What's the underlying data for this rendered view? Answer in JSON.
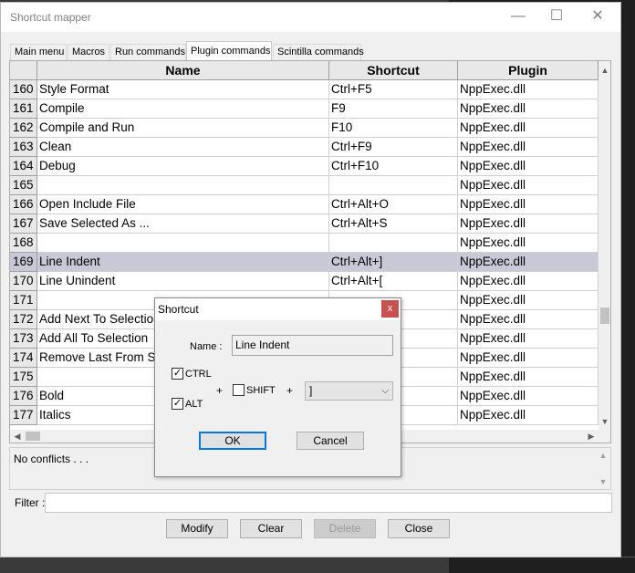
{
  "window": {
    "title": "Shortcut mapper",
    "minimize": "—",
    "maximize": "☐",
    "close": "✕"
  },
  "tabs": [
    "Main menu",
    "Macros",
    "Run commands",
    "Plugin commands",
    "Scintilla commands"
  ],
  "active_tab": "Plugin commands",
  "table": {
    "columns": [
      "Name",
      "Shortcut",
      "Plugin"
    ],
    "rows": [
      {
        "num": "160",
        "name": "Style Format",
        "shortcut": "Ctrl+F5",
        "plugin": "NppExec.dll"
      },
      {
        "num": "161",
        "name": "Compile",
        "shortcut": "F9",
        "plugin": "NppExec.dll"
      },
      {
        "num": "162",
        "name": "Compile and Run",
        "shortcut": "F10",
        "plugin": "NppExec.dll"
      },
      {
        "num": "163",
        "name": "Clean",
        "shortcut": "Ctrl+F9",
        "plugin": "NppExec.dll"
      },
      {
        "num": "164",
        "name": "Debug",
        "shortcut": "Ctrl+F10",
        "plugin": "NppExec.dll"
      },
      {
        "num": "165",
        "name": "",
        "shortcut": "",
        "plugin": "NppExec.dll"
      },
      {
        "num": "166",
        "name": "Open Include File",
        "shortcut": "Ctrl+Alt+O",
        "plugin": "NppExec.dll"
      },
      {
        "num": "167",
        "name": "Save Selected As ...",
        "shortcut": "Ctrl+Alt+S",
        "plugin": "NppExec.dll"
      },
      {
        "num": "168",
        "name": "",
        "shortcut": "",
        "plugin": "NppExec.dll"
      },
      {
        "num": "169",
        "name": "Line Indent",
        "shortcut": "Ctrl+Alt+]",
        "plugin": "NppExec.dll"
      },
      {
        "num": "170",
        "name": "Line Unindent",
        "shortcut": "Ctrl+Alt+[",
        "plugin": "NppExec.dll"
      },
      {
        "num": "171",
        "name": "",
        "shortcut": "",
        "plugin": "NppExec.dll"
      },
      {
        "num": "172",
        "name": "Add Next To Selection",
        "shortcut": "",
        "plugin": "NppExec.dll"
      },
      {
        "num": "173",
        "name": "Add All To Selection",
        "shortcut": "",
        "plugin": "NppExec.dll"
      },
      {
        "num": "174",
        "name": "Remove Last From Selection",
        "shortcut": "",
        "plugin": "NppExec.dll"
      },
      {
        "num": "175",
        "name": "",
        "shortcut": "",
        "plugin": "NppExec.dll"
      },
      {
        "num": "176",
        "name": "Bold",
        "shortcut": "",
        "plugin": "NppExec.dll"
      },
      {
        "num": "177",
        "name": "Italics",
        "shortcut": "",
        "plugin": "NppExec.dll"
      }
    ],
    "selected_row": "169"
  },
  "conflicts_text": "No conflicts . . .",
  "filter": {
    "label": "Filter :",
    "value": ""
  },
  "buttons": {
    "modify": "Modify",
    "clear": "Clear",
    "delete": "Delete",
    "close": "Close"
  },
  "dialog": {
    "title": "Shortcut",
    "close": "x",
    "name_label": "Name :",
    "name_value": "Line Indent",
    "ctrl_label": "CTRL",
    "ctrl_checked": true,
    "alt_label": "ALT",
    "alt_checked": true,
    "shift_label": "SHIFT",
    "shift_checked": false,
    "plus1": "+",
    "plus2": "+",
    "key_value": "]",
    "ok": "OK",
    "cancel": "Cancel"
  },
  "icons": {
    "scroll_up": "chevron-up-icon",
    "scroll_down": "chevron-down-icon",
    "scroll_left": "chevron-left-icon",
    "scroll_right": "chevron-right-icon",
    "check": "checkmark-icon"
  },
  "colors": {
    "selected_row": "#c8c8d6",
    "dialog_close": "#c75050",
    "default_button_border": "#0078d7"
  }
}
